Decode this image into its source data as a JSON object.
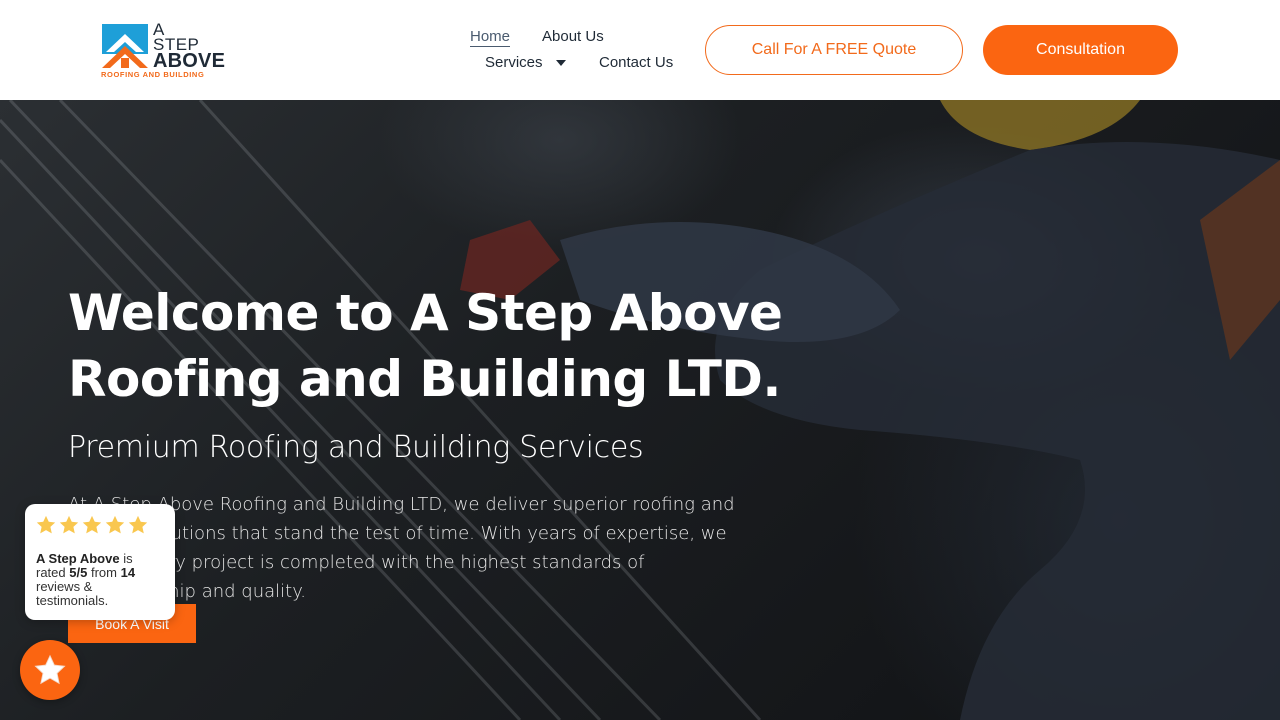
{
  "brand": {
    "line1": "A",
    "line2": "STEP",
    "line3": "ABOVE",
    "tagline": "ROOFING AND BUILDING",
    "colors": {
      "accent": "#fb6511",
      "logo_blue": "#1e9fd8",
      "text": "#1f2a36"
    }
  },
  "nav": {
    "home": "Home",
    "about": "About Us",
    "services": "Services",
    "contact": "Contact Us",
    "services_icon": "caret-down-icon"
  },
  "header_buttons": {
    "quote": "Call For A FREE Quote",
    "consultation": "Consultation"
  },
  "hero": {
    "title": "Welcome to A Step Above Roofing and Building LTD.",
    "subtitle": "Premium Roofing and Building Services",
    "body": "At A Step Above Roofing and Building LTD, we deliver superior roofing and building solutions that stand the test of time. With years of expertise, we ensure every project is completed with the highest standards of craftsmanship and quality.",
    "cta": "Book A Visit"
  },
  "review_widget": {
    "stars": 5,
    "company": "A Step Above",
    "is": "is",
    "rated_prefix": "rated",
    "rating": "5/5",
    "from": "from",
    "count": "14",
    "suffix": "reviews & testimonials.",
    "star_color": "#f9c74f",
    "fab_icon": "star-icon"
  }
}
